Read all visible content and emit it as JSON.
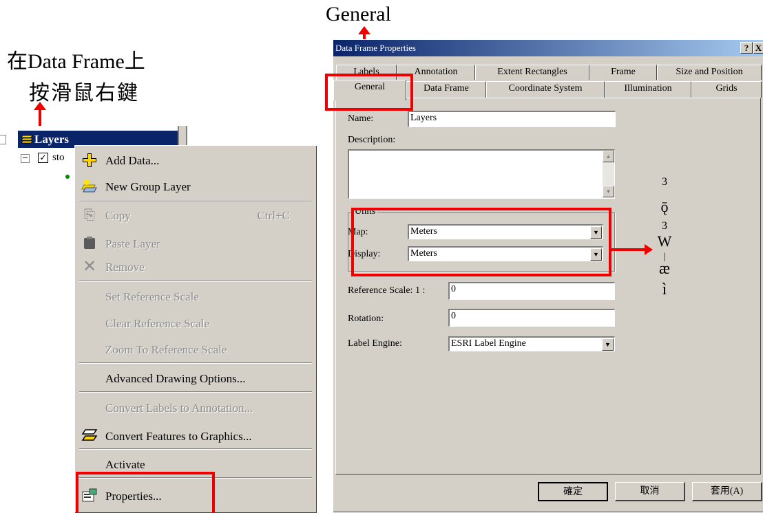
{
  "annotations": {
    "general_label": "General",
    "right_click_line1": "在Data Frame上",
    "right_click_line2": "按滑鼠右鍵",
    "side_note": [
      "3",
      "ǭ",
      "3",
      "W",
      "|",
      "æ",
      "ì"
    ]
  },
  "toc": {
    "layers_label": "Layers",
    "child_label": "sto"
  },
  "context_menu": {
    "items": [
      {
        "label": "Add Data...",
        "icon": "add-data-icon",
        "enabled": true
      },
      {
        "label": "New Group Layer",
        "icon": "group-layer-icon",
        "enabled": true
      },
      {
        "label": "Copy",
        "shortcut": "Ctrl+C",
        "icon": "copy-icon",
        "enabled": false
      },
      {
        "label": "Paste Layer",
        "icon": "paste-icon",
        "enabled": false
      },
      {
        "label": "Remove",
        "icon": "remove-icon",
        "enabled": false
      },
      {
        "label": "Set Reference Scale",
        "enabled": false
      },
      {
        "label": "Clear Reference Scale",
        "enabled": false
      },
      {
        "label": "Zoom To Reference Scale",
        "enabled": false
      },
      {
        "label": "Advanced Drawing Options...",
        "enabled": true
      },
      {
        "label": "Convert Labels to Annotation...",
        "enabled": false
      },
      {
        "label": "Convert Features to Graphics...",
        "icon": "convert-graphics-icon",
        "enabled": true
      },
      {
        "label": "Activate",
        "enabled": true
      },
      {
        "label": "Properties...",
        "icon": "properties-icon",
        "enabled": true
      }
    ]
  },
  "dialog": {
    "title": "Data Frame Properties",
    "help_btn": "?",
    "close_btn": "X",
    "tabs_back": [
      "Labels",
      "Annotation",
      "Extent Rectangles",
      "Frame",
      "Size and Position"
    ],
    "tabs_front": [
      "General",
      "Data Frame",
      "Coordinate System",
      "Illumination",
      "Grids"
    ],
    "active_tab": "General",
    "name_label": "Name:",
    "name_value": "Layers",
    "description_label": "Description:",
    "description_value": "",
    "units_label": "Units",
    "map_label": "Map:",
    "map_value": "Meters",
    "display_label": "Display:",
    "display_value": "Meters",
    "ref_scale_label": "Reference Scale: 1 :",
    "ref_scale_value": "0",
    "rotation_label": "Rotation:",
    "rotation_value": "0",
    "label_engine_label": "Label Engine:",
    "label_engine_value": "ESRI Label Engine",
    "ok_btn": "確定",
    "cancel_btn": "取消",
    "apply_btn": "套用(A)"
  },
  "colors": {
    "highlight": "#ee0000",
    "titlebar": "#0a246a",
    "face": "#d4d0c8"
  }
}
